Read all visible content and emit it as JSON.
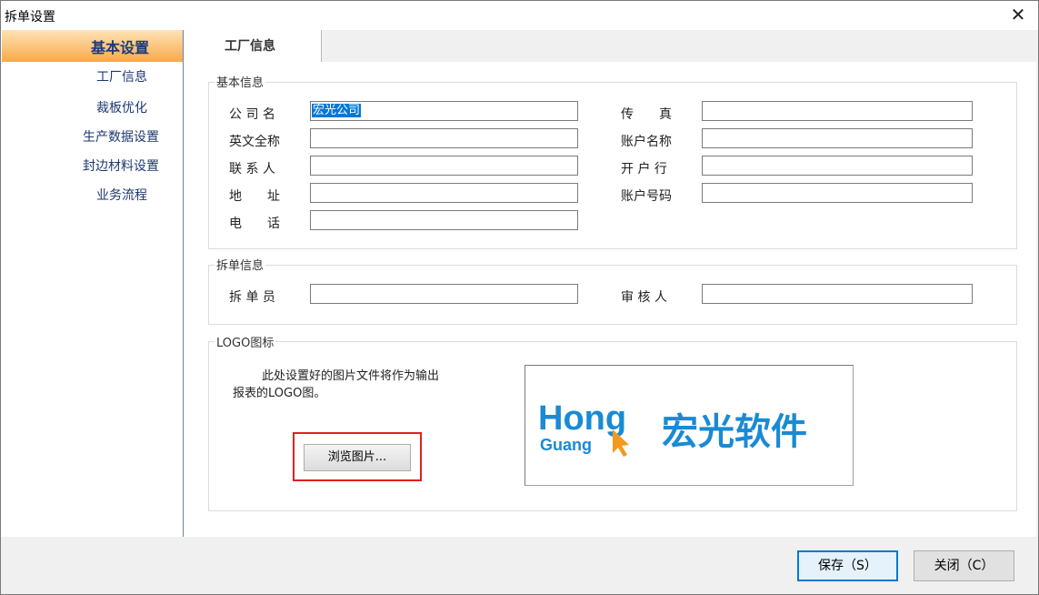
{
  "window": {
    "title": "拆单设置",
    "close_symbol": "✕"
  },
  "sidebar": {
    "header": "基本设置",
    "items": [
      "工厂信息",
      "裁板优化",
      "生产数据设置",
      "封边材料设置",
      "业务流程"
    ]
  },
  "tab": {
    "label": "工厂信息"
  },
  "basic_info": {
    "title": "基本信息",
    "company_name": {
      "label": "公 司 名",
      "value": "宏光公司"
    },
    "fax": {
      "label": "传　　真",
      "value": ""
    },
    "english_name": {
      "label": "英文全称",
      "value": ""
    },
    "account_name": {
      "label": "账户名称",
      "value": ""
    },
    "contact": {
      "label": "联 系 人",
      "value": ""
    },
    "bank": {
      "label": "开 户 行",
      "value": ""
    },
    "address": {
      "label": "地　　址",
      "value": ""
    },
    "account_number": {
      "label": "账户号码",
      "value": ""
    },
    "phone": {
      "label": "电　　话",
      "value": ""
    }
  },
  "split_info": {
    "title": "拆单信息",
    "splitter": {
      "label": "拆 单 员",
      "value": ""
    },
    "reviewer": {
      "label": "审 核 人",
      "value": ""
    }
  },
  "logo": {
    "title": "LOGO图标",
    "hint_line1": "此处设置好的图片文件将作为输出",
    "hint_line2": "报表的LOGO图。",
    "browse_label": "浏览图片...",
    "brand_hong": "Hong",
    "brand_guang": "Guang",
    "brand_cn": "宏光软件",
    "brand_color": "#1a8ad4",
    "cursor_color": "#f39a1e"
  },
  "footer": {
    "save_label": "保存（S）",
    "close_label": "关闭（C）"
  }
}
